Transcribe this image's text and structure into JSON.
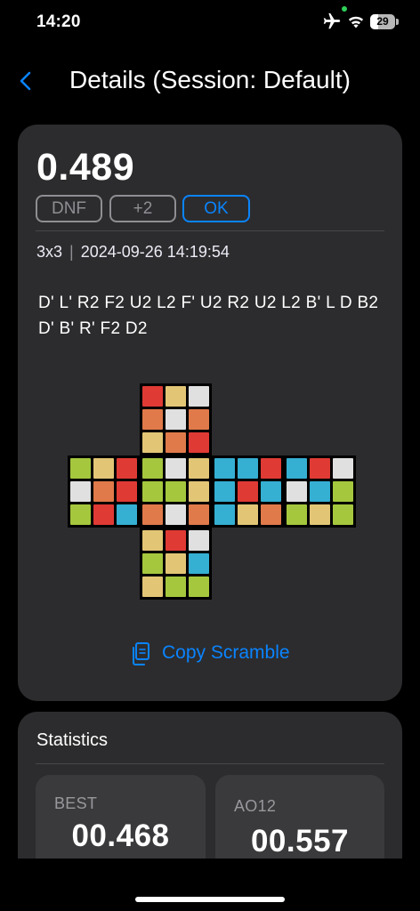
{
  "status_bar": {
    "time": "14:20",
    "battery_level": "29"
  },
  "nav": {
    "title": "Details (Session: Default)",
    "back_icon": "chevron-left-icon"
  },
  "solve": {
    "time": "0.489",
    "penalties": [
      "DNF",
      "+2",
      "OK"
    ],
    "selected_penalty": "OK",
    "puzzle": "3x3",
    "datetime": "2024-09-26 14:19:54",
    "scramble": "D' L' R2 F2 U2 L2 F' U2 R2 U2 L2 B' L D B2 D' B' R' F2 D2",
    "copy_label": "Copy Scramble"
  },
  "cube": {
    "palette": {
      "W": "#e0e0e0",
      "Y": "#e2c676",
      "R": "#e03a35",
      "O": "#e07a4a",
      "G": "#a5c73e",
      "B": "#35afd2"
    },
    "faces": {
      "U": [
        "R",
        "Y",
        "W",
        "O",
        "W",
        "O",
        "Y",
        "O",
        "R"
      ],
      "L": [
        "G",
        "Y",
        "R",
        "W",
        "O",
        "R",
        "G",
        "R",
        "B"
      ],
      "F": [
        "G",
        "W",
        "Y",
        "G",
        "G",
        "Y",
        "O",
        "W",
        "O"
      ],
      "R": [
        "B",
        "B",
        "R",
        "B",
        "R",
        "B",
        "B",
        "Y",
        "O"
      ],
      "B": [
        "B",
        "R",
        "W",
        "W",
        "B",
        "G",
        "G",
        "Y",
        "G"
      ],
      "D": [
        "Y",
        "R",
        "W",
        "G",
        "Y",
        "B",
        "Y",
        "G",
        "G"
      ]
    }
  },
  "statistics": {
    "title": "Statistics",
    "best": {
      "label": "BEST",
      "value": "00.468"
    },
    "ao12": {
      "label": "AO12",
      "value": "00.557"
    }
  },
  "colors": {
    "accent": "#0a84ff",
    "card_bg": "#2c2c2e",
    "tile_bg": "#3a3a3c",
    "muted": "#8e8e93"
  }
}
